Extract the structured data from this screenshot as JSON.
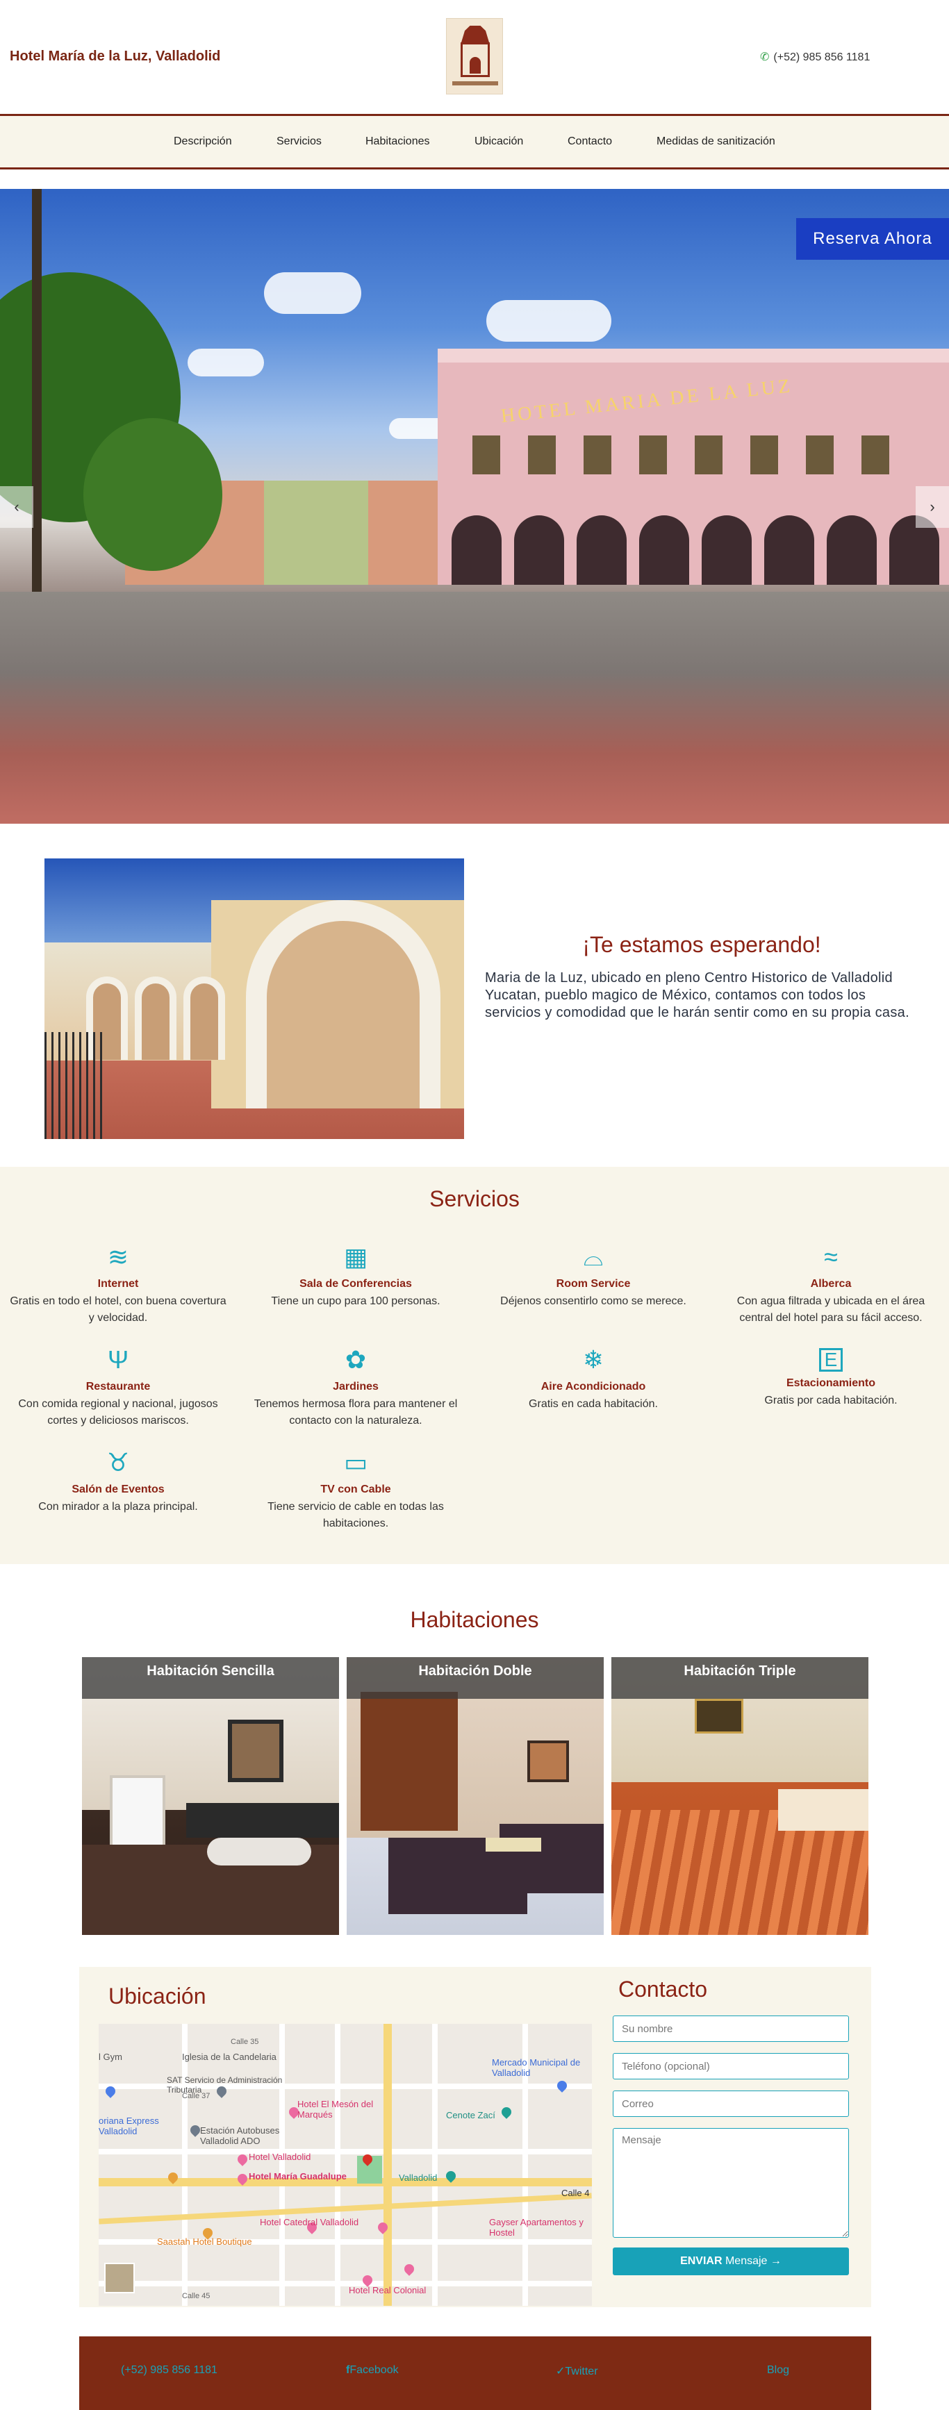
{
  "header": {
    "brand": "Hotel María de la Luz, Valladolid",
    "phone_icon": "phone-icon",
    "phone": "(+52) 985 856 1181"
  },
  "nav": {
    "items": [
      "Descripción",
      "Servicios",
      "Habitaciones",
      "Ubicación",
      "Contacto",
      "Medidas de sanitización"
    ]
  },
  "hero": {
    "reserve_label": "Reserva Ahora",
    "prev_label": "‹",
    "next_label": "›",
    "sign_text": "HOTEL MARIA DE LA LUZ"
  },
  "welcome": {
    "title": "¡Te estamos esperando!",
    "text": "Maria de la Luz, ubicado en pleno Centro Historico de Valladolid Yucatan, pueblo magico de México, contamos con todos los servicios y comodidad que le harán sentir como en su propia casa."
  },
  "services": {
    "title": "Servicios",
    "items": [
      {
        "icon": "wifi-icon",
        "glyph": "≋",
        "name": "Internet",
        "desc": "Gratis en todo el hotel, con buena covertura y velocidad."
      },
      {
        "icon": "conference-icon",
        "glyph": "▦",
        "name": "Sala de Conferencias",
        "desc": "Tiene un cupo para 100 personas."
      },
      {
        "icon": "room-service-icon",
        "glyph": "⌓",
        "name": "Room Service",
        "desc": "Déjenos consentirlo como se merece."
      },
      {
        "icon": "pool-icon",
        "glyph": "≈",
        "name": "Alberca",
        "desc": "Con agua filtrada y ubicada en el área central del hotel para su fácil acceso."
      },
      {
        "icon": "restaurant-icon",
        "glyph": "Ψ",
        "name": "Restaurante",
        "desc": "Con comida regional y nacional, jugosos cortes y deliciosos mariscos."
      },
      {
        "icon": "garden-icon",
        "glyph": "✿",
        "name": "Jardines",
        "desc": "Tenemos hermosa flora para mantener el contacto con la naturaleza."
      },
      {
        "icon": "snowflake-icon",
        "glyph": "❄",
        "name": "Aire Acondicionado",
        "desc": "Gratis en cada habitación."
      },
      {
        "icon": "parking-icon",
        "glyph": "E",
        "name": "Estacionamiento",
        "desc": "Gratis por cada habitación."
      },
      {
        "icon": "cheers-icon",
        "glyph": "♉",
        "name": "Salón de Eventos",
        "desc": "Con mirador a la plaza principal."
      },
      {
        "icon": "tv-icon",
        "glyph": "▭",
        "name": "TV con Cable",
        "desc": "Tiene servicio de cable en todas las habitaciones."
      }
    ]
  },
  "rooms": {
    "title": "Habitaciones",
    "items": [
      {
        "name": "Habitación Sencilla"
      },
      {
        "name": "Habitación Doble"
      },
      {
        "name": "Habitación Triple"
      }
    ]
  },
  "location": {
    "title": "Ubicación",
    "map_labels": [
      "Iglesia de la Candelaria",
      "SAT Servicio de Administración Tributaria",
      "Mercado Municipal de Valladolid",
      "Hotel El Mesón del Marqués",
      "Cenote Zací",
      "oriana Express Valladolid",
      "Estación Autobuses Valladolid ADO",
      "Hotel Valladolid",
      "Hotel María Guadalupe",
      "Valladolid",
      "Hotel Catedral Valladolid",
      "Gayser Apartamentos y Hostel",
      "Saastah Hotel Boutique",
      "Hotel Real Colonial",
      "Calle 4",
      "Calle 45",
      "Calle 37",
      "Calle 35",
      "l Gym"
    ]
  },
  "contact": {
    "title": "Contacto",
    "name_placeholder": "Su nombre",
    "phone_placeholder": "Teléfono (opcional)",
    "email_placeholder": "Correo",
    "message_placeholder": "Mensaje",
    "send_bold": "ENVIAR",
    "send_rest": " Mensaje →"
  },
  "footer": {
    "phone": "(+52) 985 856 1181",
    "facebook": "Facebook",
    "twitter": "Twitter",
    "blog": "Blog"
  },
  "colors": {
    "accent_red": "#8b2315",
    "accent_teal": "#18a2b8",
    "reserve_blue": "#1a3ec2",
    "cream": "#f8f5ea"
  }
}
